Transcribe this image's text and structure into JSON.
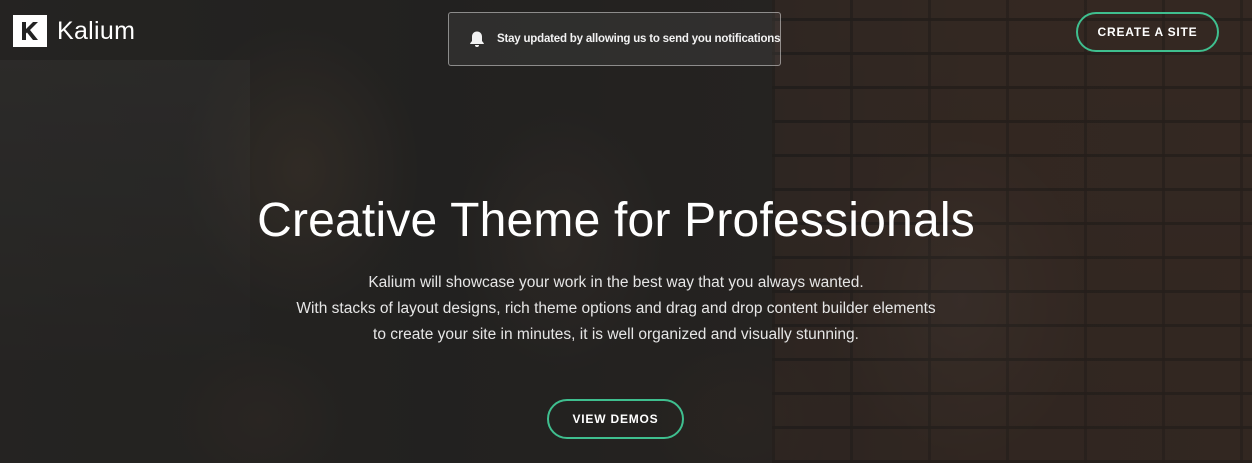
{
  "header": {
    "logo_text": "Kalium",
    "logo_icon": "kalium-k-logo-icon",
    "notification_text": "Stay updated by allowing us to send you notifications",
    "notification_icon": "bell-icon",
    "create_site_label": "CREATE A SITE"
  },
  "hero": {
    "headline": "Creative Theme for Professionals",
    "description_lines": [
      "Kalium will showcase your work in the best way that you always wanted.",
      "With stacks of layout designs, rich theme options and drag and drop content builder elements",
      "to create your site in minutes, it is well organized and visually stunning."
    ],
    "cta_label": "VIEW DEMOS"
  },
  "colors": {
    "accent": "#3fbf8f",
    "text": "#ffffff"
  }
}
